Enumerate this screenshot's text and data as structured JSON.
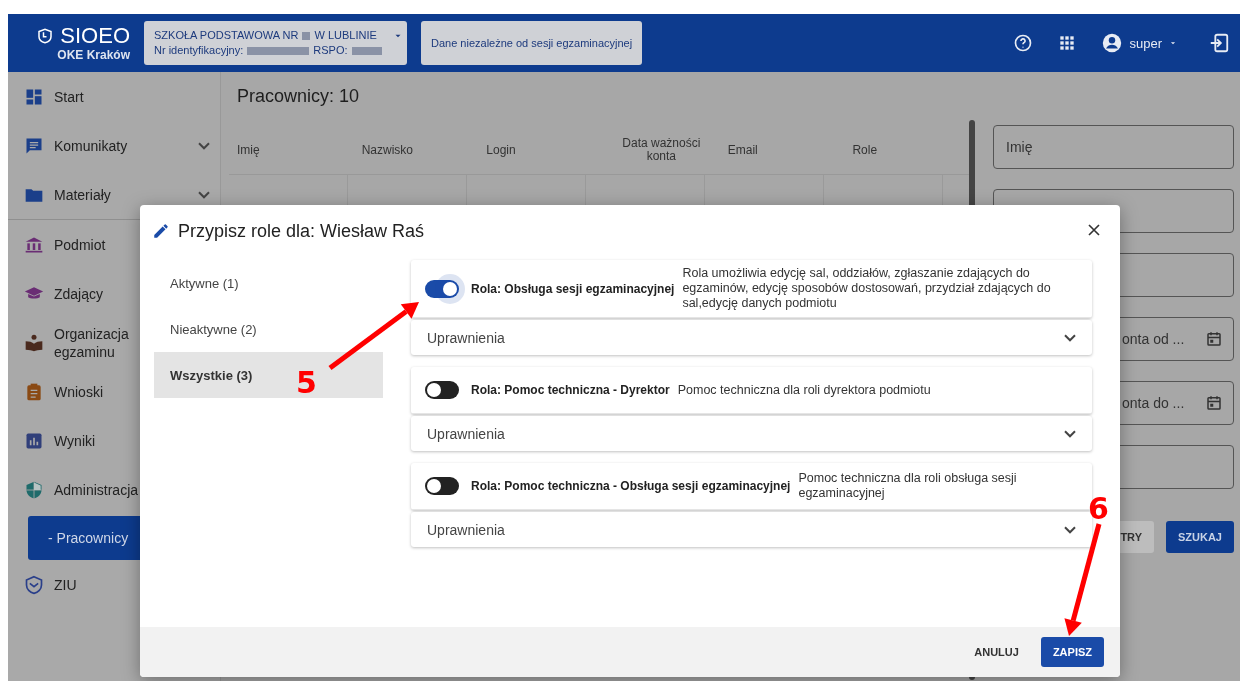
{
  "header": {
    "logo": {
      "title": "SIOEO",
      "subtitle": "OKE Kraków"
    },
    "school": {
      "name_start": "SZKOŁA PODSTAWOWA NR",
      "name_end": "W LUBLINIE",
      "id_label": "Nr identyfikacyjny:",
      "rspo_label": "RSPO:"
    },
    "session": "Dane niezależne od sesji egzaminacyjnej",
    "user": "super"
  },
  "sidebar": {
    "sections": [
      {
        "items": [
          {
            "label": "Start",
            "expandable": false,
            "selected": false
          },
          {
            "label": "Komunikaty",
            "expandable": true,
            "selected": false
          },
          {
            "label": "Materiały",
            "expandable": true,
            "selected": false
          }
        ]
      },
      {
        "items": [
          {
            "label": "Podmiot",
            "expandable": false,
            "selected": false
          },
          {
            "label": "Zdający",
            "expandable": false,
            "selected": false
          },
          {
            "label": "Organizacja egzaminu",
            "expandable": false,
            "selected": false
          },
          {
            "label": "Wnioski",
            "expandable": false,
            "selected": false
          },
          {
            "label": "Wyniki",
            "expandable": false,
            "selected": false
          },
          {
            "label": "Administracja",
            "expandable": false,
            "selected": false,
            "children": [
              {
                "label": "- Pracownicy",
                "selected": true
              }
            ]
          },
          {
            "label": "ZIU",
            "expandable": false,
            "selected": false
          }
        ]
      }
    ]
  },
  "page": {
    "title": "Pracownicy: 10",
    "table": {
      "columns": [
        "Imię",
        "Nazwisko",
        "Login",
        "Data ważności konta",
        "Email",
        "Role"
      ]
    },
    "filters": {
      "fields": [
        {
          "placeholder": "Imię",
          "kind": "text"
        },
        {
          "kind": "text"
        },
        {
          "kind": "text"
        },
        {
          "placeholder": "onta od ...",
          "kind": "date"
        },
        {
          "placeholder": "onta do ...",
          "kind": "date"
        },
        {
          "kind": "text"
        }
      ],
      "buttons": [
        "TRY",
        "SZUKAJ"
      ]
    }
  },
  "dialog": {
    "title": "Przypisz role dla: Wiesław Raś",
    "tabs": [
      {
        "label": "Aktywne (1)",
        "selected": false
      },
      {
        "label": "Nieaktywne (2)",
        "selected": false
      },
      {
        "label": "Wszystkie (3)",
        "selected": true
      }
    ],
    "roles": [
      {
        "name": "Rola: Obsługa sesji egzaminacyjnej",
        "description": "Rola umożliwia edycję sal, oddziałów, zgłaszanie zdających do egzaminów, edycję sposobów dostosowań, przydział zdających do sal,edycję danych podmiotu",
        "on": true,
        "permissions": "Uprawnienia"
      },
      {
        "name": "Rola: Pomoc techniczna - Dyrektor",
        "description": "Pomoc techniczna dla roli dyrektora podmiotu",
        "on": false,
        "permissions": "Uprawnienia"
      },
      {
        "name": "Rola: Pomoc techniczna - Obsługa sesji egzaminacyjnej",
        "description": "Pomoc techniczna dla roli obsługa sesji egzaminacyjnej",
        "on": false,
        "permissions": "Uprawnienia"
      }
    ],
    "buttons": {
      "cancel": "ANULUJ",
      "save": "ZAPISZ"
    }
  },
  "annotations": [
    {
      "label": "5"
    },
    {
      "label": "6"
    }
  ]
}
